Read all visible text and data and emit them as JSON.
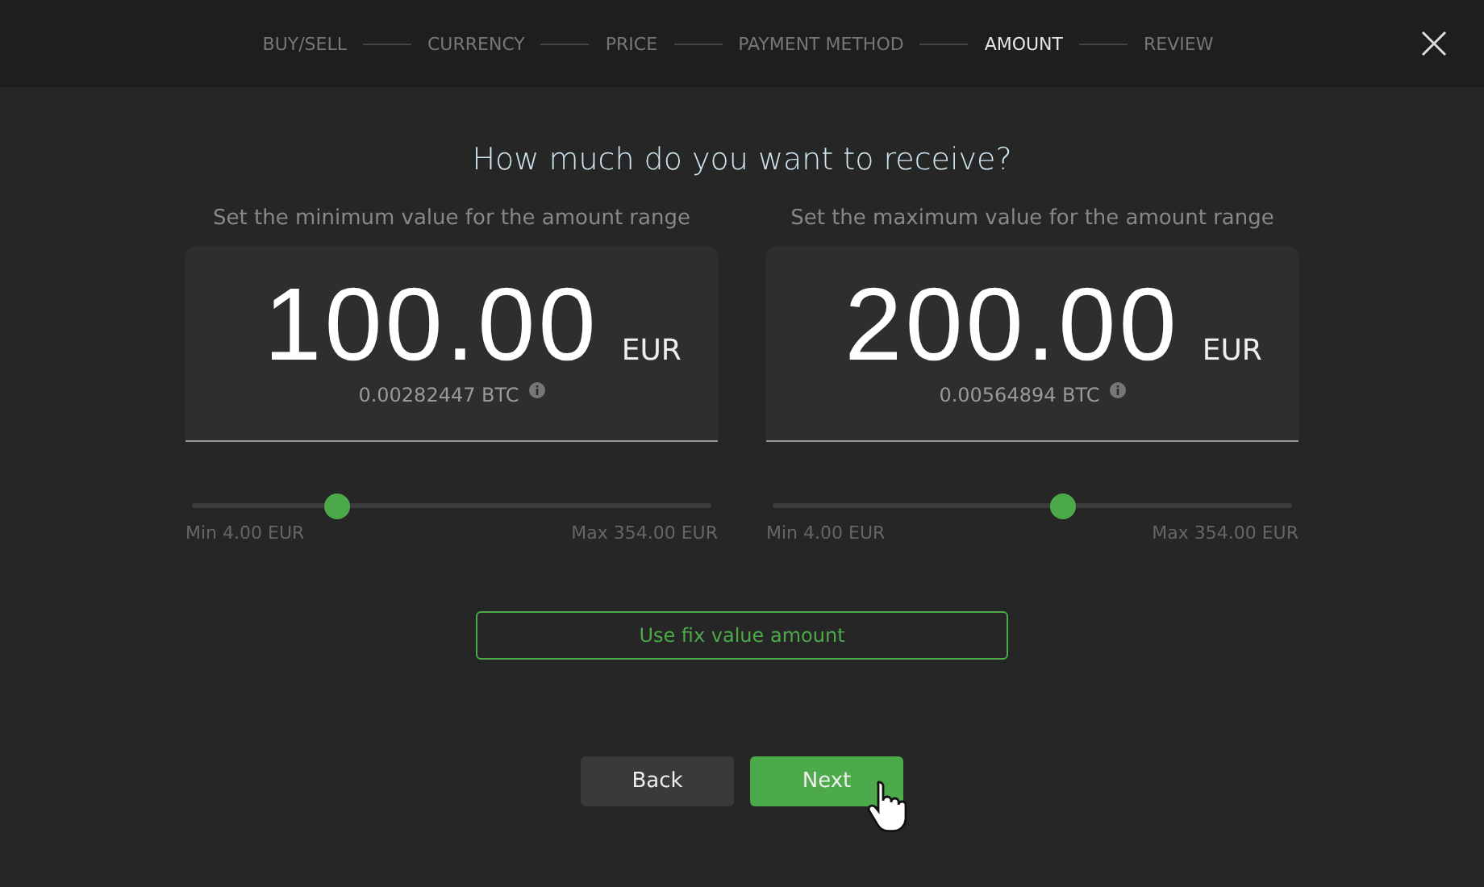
{
  "steps": [
    {
      "label": "BUY/SELL",
      "selected": false
    },
    {
      "label": "CURRENCY",
      "selected": false
    },
    {
      "label": "PRICE",
      "selected": false
    },
    {
      "label": "PAYMENT METHOD",
      "selected": false
    },
    {
      "label": "AMOUNT",
      "selected": true
    },
    {
      "label": "REVIEW",
      "selected": false
    }
  ],
  "heading": "How much do you want to receive?",
  "ranges": [
    {
      "caption": "Set the minimum value for the amount range",
      "amount": "100.00",
      "currency": "EUR",
      "converted": "0.00282447 BTC",
      "level": 0.28,
      "min_label": "Min 4.00 EUR",
      "max_label": "Max 354.00 EUR"
    },
    {
      "caption": "Set the maximum value for the amount range",
      "amount": "200.00",
      "currency": "EUR",
      "converted": "0.00564894 BTC",
      "level": 0.56,
      "min_label": "Min 4.00 EUR",
      "max_label": "Max 354.00 EUR"
    }
  ],
  "fix_button": "Use fix value amount",
  "buttons": [
    {
      "label": "Back",
      "kind": "secondary"
    },
    {
      "label": "Next",
      "kind": "primary"
    }
  ]
}
